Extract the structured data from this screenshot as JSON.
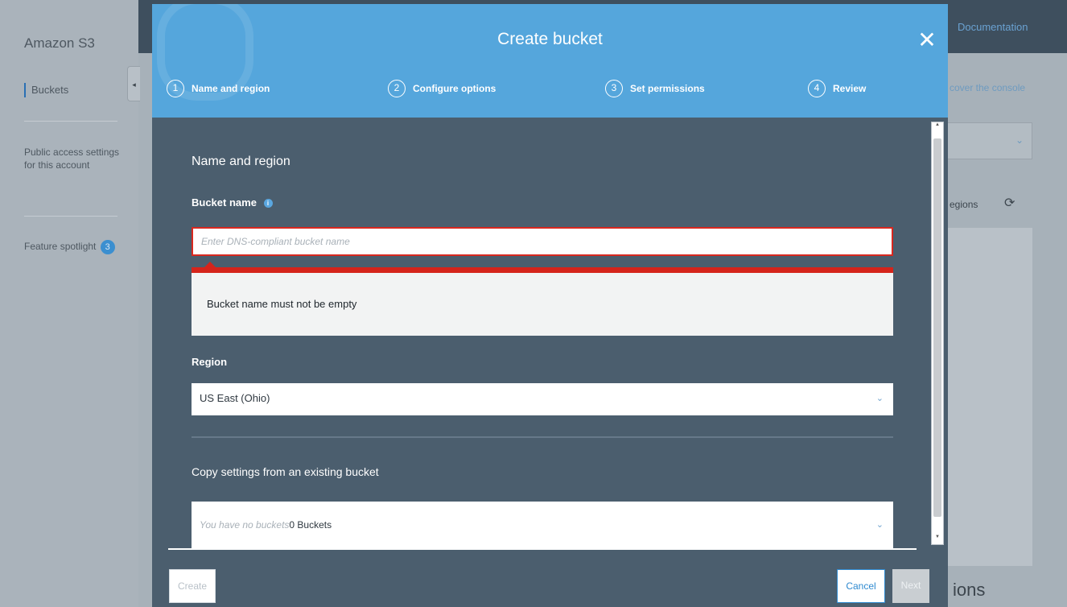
{
  "console": {
    "service_title": "Amazon S3",
    "sidebar": {
      "buckets_label": "Buckets",
      "public_access_label": "Public access settings for this account",
      "feature_spotlight_label": "Feature spotlight",
      "feature_spotlight_count": "3",
      "collapse_glyph": "◂"
    },
    "documentation_link": "Documentation",
    "discover_link": "cover the console",
    "regions_text": "egions",
    "partial_heading": "ions"
  },
  "modal": {
    "title": "Create bucket",
    "close_glyph": "✕",
    "steps": [
      {
        "number": "1",
        "label": "Name and region"
      },
      {
        "number": "2",
        "label": "Configure options"
      },
      {
        "number": "3",
        "label": "Set permissions"
      },
      {
        "number": "4",
        "label": "Review"
      }
    ],
    "section_heading": "Name and region",
    "bucket_name": {
      "label": "Bucket name",
      "value": "",
      "placeholder": "Enter DNS-compliant bucket name",
      "error": "Bucket name must not be empty"
    },
    "region": {
      "label": "Region",
      "selected": "US East (Ohio)"
    },
    "copy_settings": {
      "heading": "Copy settings from an existing bucket",
      "placeholder_italic": "You have no buckets",
      "value": "0 Buckets"
    },
    "buttons": {
      "create": "Create",
      "cancel": "Cancel",
      "next": "Next"
    }
  },
  "colors": {
    "modal_header": "#55a6dc",
    "modal_body": "#4b5e6e",
    "error": "#d5241b",
    "accent": "#2f8ad0"
  }
}
